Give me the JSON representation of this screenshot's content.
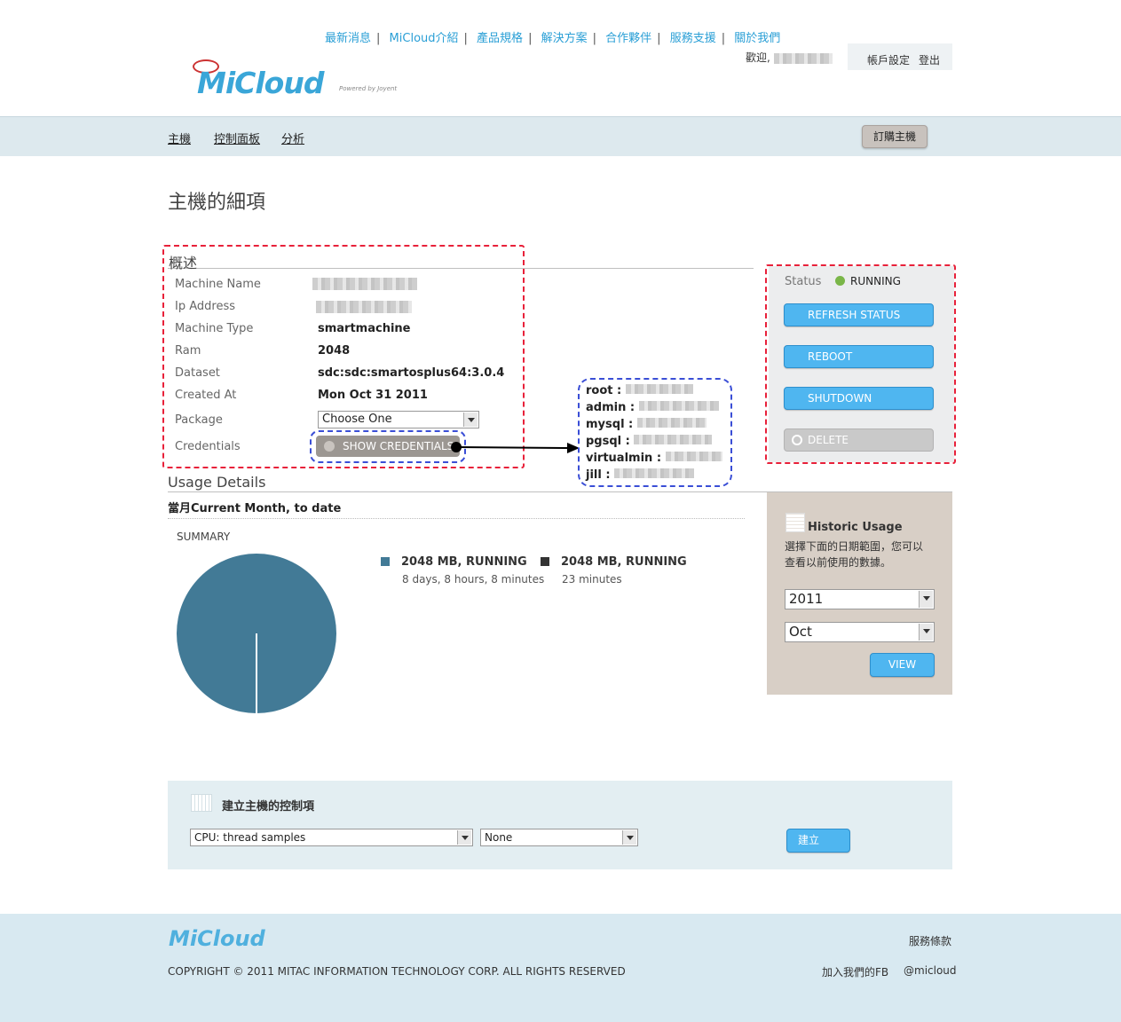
{
  "top_nav": {
    "items": [
      "最新消息",
      "MiCloud介紹",
      "產品規格",
      "解決方案",
      "合作夥伴",
      "服務支援",
      "關於我們"
    ]
  },
  "logo": {
    "text": "MiCloud",
    "sub": "Powered by Joyent"
  },
  "header": {
    "welcome": "歡迎,",
    "account_settings": "帳戶設定",
    "logout": "登出"
  },
  "subnav": {
    "items": [
      "主機",
      "控制面板",
      "分析"
    ],
    "order_button": "訂購主機"
  },
  "page_title": "主機的細項",
  "overview": {
    "title": "概述",
    "rows": [
      {
        "label": "Machine Name",
        "value": ""
      },
      {
        "label": "Ip Address",
        "value": ""
      },
      {
        "label": "Machine Type",
        "value": "smartmachine"
      },
      {
        "label": "Ram",
        "value": "2048"
      },
      {
        "label": "Dataset",
        "value": "sdc:sdc:smartosplus64:3.0.4"
      },
      {
        "label": "Created At",
        "value": "Mon Oct 31 2011"
      },
      {
        "label": "Package",
        "value": ""
      },
      {
        "label": "Credentials",
        "value": ""
      }
    ],
    "package_select": "Choose One",
    "show_credentials": "SHOW CREDENTIALS"
  },
  "credentials": [
    "root :",
    "admin :",
    "mysql :",
    "pgsql :",
    "virtualmin :",
    "jill :"
  ],
  "status_panel": {
    "status_label": "Status",
    "status_value": "RUNNING",
    "buttons": [
      "REFRESH STATUS",
      "REBOOT",
      "SHUTDOWN",
      "DELETE"
    ],
    "status_color": "#7ab648"
  },
  "usage": {
    "title": "Usage Details",
    "period": "當月Current Month, to date",
    "summary": "SUMMARY",
    "legend": [
      {
        "title": "2048 MB, RUNNING",
        "sub": "8 days, 8 hours, 8 minutes",
        "color": "#427a96"
      },
      {
        "title": "2048 MB, RUNNING",
        "sub": "23 minutes",
        "color": "#333333"
      }
    ]
  },
  "historic": {
    "title": "Historic Usage",
    "desc1": "選擇下面的日期範圍，您可以",
    "desc2": "查看以前使用的數據。",
    "year": "2011",
    "month": "Oct",
    "view_button": "VIEW"
  },
  "create": {
    "title": "建立主機的控制項",
    "metric_select": "CPU: thread samples",
    "decomp_select": "None",
    "create_button": "建立"
  },
  "footer": {
    "logo": "MiCloud",
    "copyright": "COPYRIGHT © 2011 MITAC INFORMATION TECHNOLOGY CORP. ALL RIGHTS RESERVED",
    "terms": "服務條款",
    "fb": "加入我們的FB",
    "twitter": "@micloud"
  }
}
